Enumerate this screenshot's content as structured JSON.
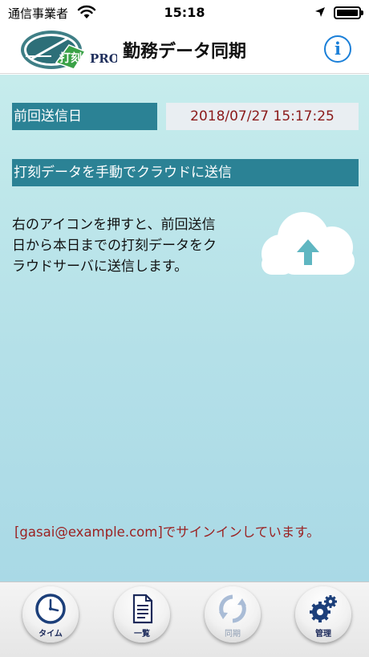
{
  "status_bar": {
    "carrier": "通信事業者",
    "time": "15:18"
  },
  "header": {
    "logo_text": "打刻",
    "logo_suffix": "PRO",
    "title": "勤務データ同期",
    "info_label": "i"
  },
  "main": {
    "last_sent_label": "前回送信日",
    "last_sent_value": "2018/07/27 15:17:25",
    "manual_send_label": "打刻データを手動でクラウドに送信",
    "description_lines": [
      "右のアイコンを押すと、前回送信",
      "日から本日までの打刻データをク",
      "ラウドサーバに送信します。"
    ],
    "signin_status": "[gasai@example.com]でサインインしています。"
  },
  "tab_bar": {
    "tabs": [
      {
        "label": "タイム",
        "icon": "clock-icon"
      },
      {
        "label": "一覧",
        "icon": "document-icon"
      },
      {
        "label": "同期",
        "icon": "sync-icon"
      },
      {
        "label": "管理",
        "icon": "gear-icon"
      }
    ]
  },
  "colors": {
    "section_label_bg": "#2b8295",
    "value_text": "#8b1a1a",
    "info_blue": "#1a7fd8",
    "tab_label": "#1c2a5a"
  }
}
